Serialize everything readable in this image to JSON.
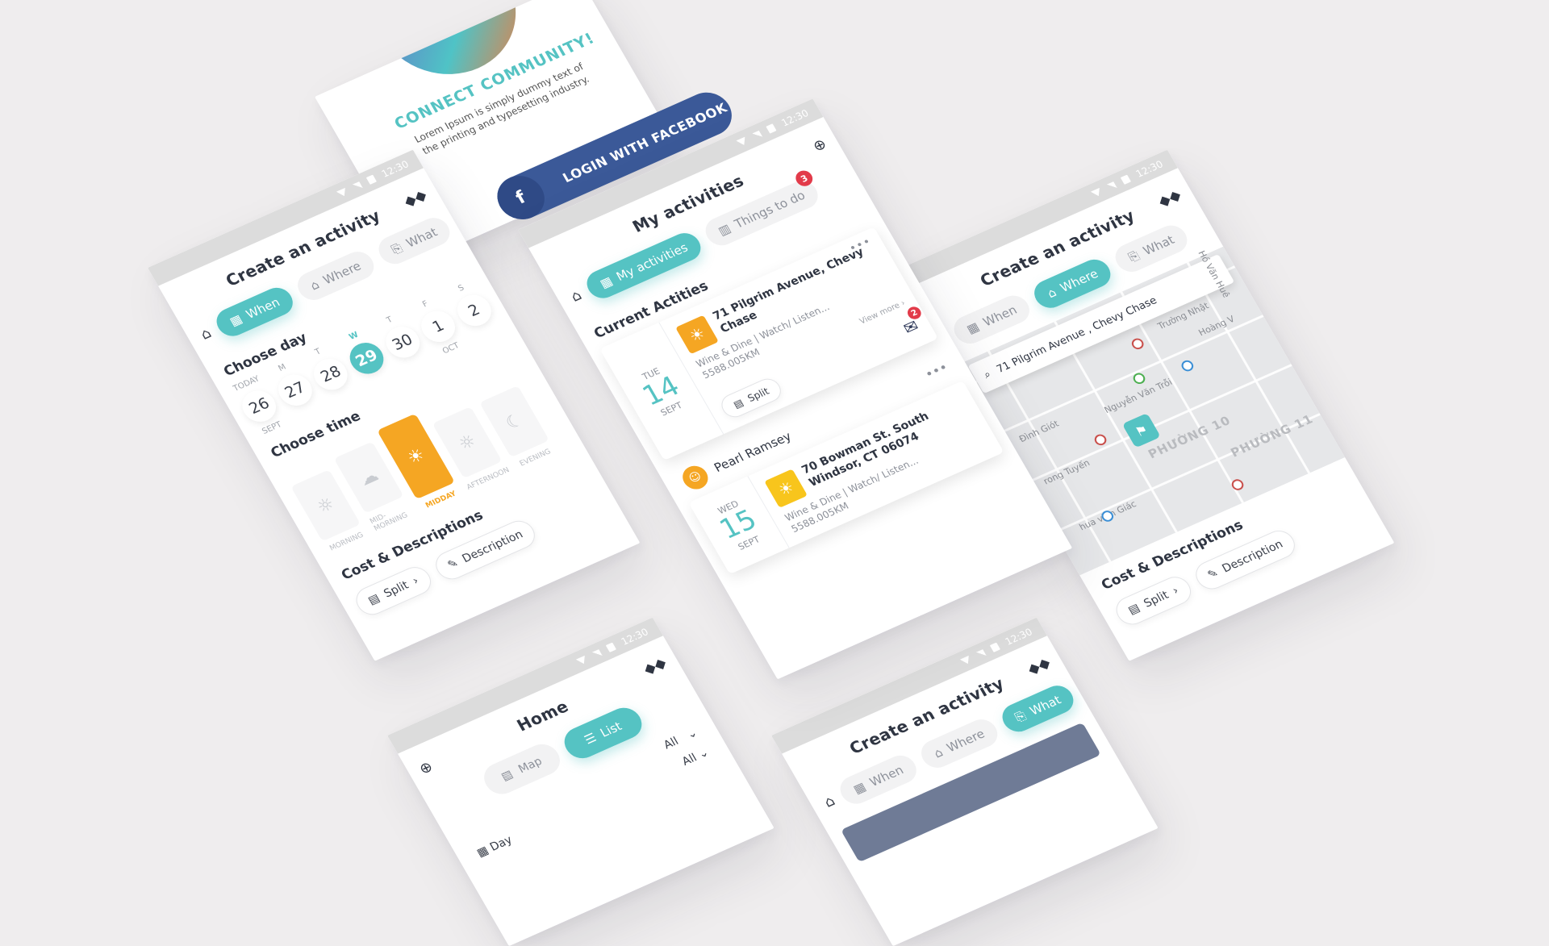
{
  "status": {
    "time": "12:30"
  },
  "colors": {
    "accent": "#55c3c3",
    "orange": "#f5a623",
    "facebook": "#3b5998",
    "badge": "#e23b4a"
  },
  "login": {
    "heading": "CONNECT COMMUNITY!",
    "body": "Lorem Ipsum is simply dummy text of the printing and typesetting industry.",
    "button": "LOGIN WITH FACEBOOK",
    "button_icon": "facebook-icon"
  },
  "create_when": {
    "title": "Create an activity",
    "tabs": [
      {
        "label": "When",
        "icon": "calendar-icon"
      },
      {
        "label": "Where",
        "icon": "store-icon"
      },
      {
        "label": "What",
        "icon": "ticket-icon"
      }
    ],
    "choose_day": "Choose day",
    "days": [
      {
        "label": "TODAY",
        "num": "26",
        "sub": "SEPT"
      },
      {
        "label": "M",
        "num": "27"
      },
      {
        "label": "T",
        "num": "28"
      },
      {
        "label": "W",
        "num": "29"
      },
      {
        "label": "T",
        "num": "30"
      },
      {
        "label": "F",
        "num": "1",
        "sub": "OCT"
      },
      {
        "label": "S",
        "num": "2"
      }
    ],
    "choose_time": "Choose time",
    "times": [
      "MORNING",
      "MID-MORNING",
      "MIDDAY",
      "AFTERNOON",
      "EVENING"
    ],
    "cost_title": "Cost & Descriptions",
    "split": "Split",
    "description": "Description"
  },
  "activities": {
    "title": "My activities",
    "tabs": [
      {
        "label": "My activities"
      },
      {
        "label": "Things to do",
        "badge": "3"
      }
    ],
    "current": "Current Actities",
    "cards": [
      {
        "weekday": "TUE",
        "day": "14",
        "month": "SEPT",
        "address": "71 Pilgrim Avenue, Chevy Chase",
        "category": "Wine & Dine | Watch/ Listen...",
        "distance": "5588.005KM",
        "view_more": "View more",
        "split": "Split",
        "chat_badge": "2"
      },
      {
        "person": "Pearl Ramsey",
        "weekday": "WED",
        "day": "15",
        "month": "SEPT",
        "address": "70 Bowman St. South Windsor, CT 06074",
        "category": "Wine & Dine | Watch/ Listen...",
        "distance": "5588.005KM"
      }
    ]
  },
  "create_where": {
    "title": "Create an activity",
    "tabs": [
      {
        "label": "When"
      },
      {
        "label": "Where"
      },
      {
        "label": "What"
      }
    ],
    "search": "71 Pilgrim Avenue , Chevy Chase",
    "map_labels": [
      "Trường Nhật",
      "Hồ Văn Huê",
      "Hoàng V",
      "Nguyễn Văn Trỗi",
      "Đình Giót",
      "rong Tuyến",
      "hua viên Giác"
    ],
    "map_districts": [
      "PHƯỜNG 10",
      "PHƯỜNG 11"
    ],
    "cost_title": "Cost & Descriptions",
    "split": "Split",
    "description": "Description"
  },
  "home": {
    "title": "Home",
    "map": "Map",
    "list": "List",
    "filter1": "All",
    "filter2": "All",
    "day": "Day"
  },
  "create_what": {
    "title": "Create an activity",
    "tabs": [
      {
        "label": "When"
      },
      {
        "label": "Where"
      },
      {
        "label": "What"
      }
    ]
  }
}
